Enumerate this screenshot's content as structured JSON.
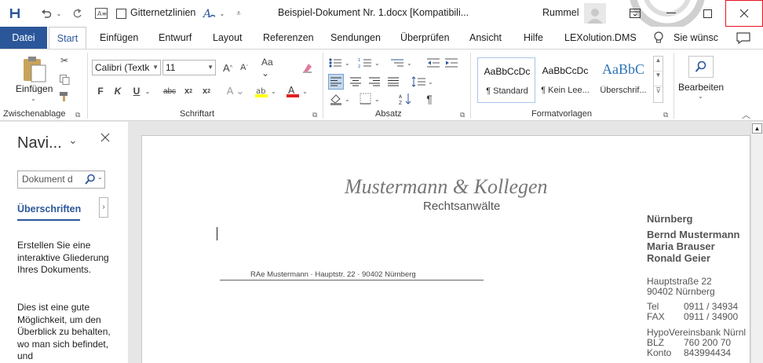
{
  "titlebar": {
    "gridlines_label": "Gitternetzlinien",
    "doc_title": "Beispiel-Dokument Nr. 1.docx [Kompatibili...",
    "user_name": "Rummel"
  },
  "tabs": {
    "file": "Datei",
    "start": "Start",
    "insert": "Einfügen",
    "design": "Entwurf",
    "layout": "Layout",
    "references": "Referenzen",
    "mailings": "Sendungen",
    "review": "Überprüfen",
    "view": "Ansicht",
    "help": "Hilfe",
    "lexolution": "LEXolution.DMS",
    "search": "Sie wünsc"
  },
  "ribbon": {
    "paste_label": "Einfügen",
    "clipboard_group": "Zwischenablage",
    "font_name": "Calibri (Textk",
    "font_size": "11",
    "font_group": "Schriftart",
    "paragraph_group": "Absatz",
    "styles_group": "Formatvorlagen",
    "styles": [
      {
        "preview": "AaBbCcDc",
        "name": "¶ Standard"
      },
      {
        "preview": "AaBbCcDc",
        "name": "¶ Kein Lee..."
      },
      {
        "preview": "AaBbC",
        "name": "Überschrif..."
      }
    ],
    "editing_label": "Bearbeiten"
  },
  "navpane": {
    "title": "Navi...",
    "search_placeholder": "Dokument d",
    "tab_headings": "Überschriften",
    "para1": "Erstellen Sie eine interaktive Gliederung Ihres Dokuments.",
    "para2": "Dies ist eine gute Möglichkeit, um den Überblick zu behalten, wo man sich befindet, und"
  },
  "document": {
    "firm_name": "Mustermann & Kollegen",
    "firm_sub": "Rechtsanwälte",
    "sender_line": "RAe Mustermann · Hauptstr. 22 · 90402 Nürnberg",
    "city": "Nürnberg",
    "partners": [
      "Bernd Mustermann",
      "Maria Brauser",
      "Ronald Geier"
    ],
    "street": "Hauptstraße 22",
    "zip_city": "90402 Nürnberg",
    "tel_label": "Tel",
    "tel_value": "0911 / 34934",
    "fax_label": "FAX",
    "fax_value": "0911 / 34900",
    "bank": "HypoVereinsbank Nürnl",
    "blz_label": "BLZ",
    "blz_value": "760 200 70",
    "konto_label": "Konto",
    "konto_value": "843994434"
  },
  "colors": {
    "accent": "#2b579a",
    "close_border": "#e81123"
  }
}
